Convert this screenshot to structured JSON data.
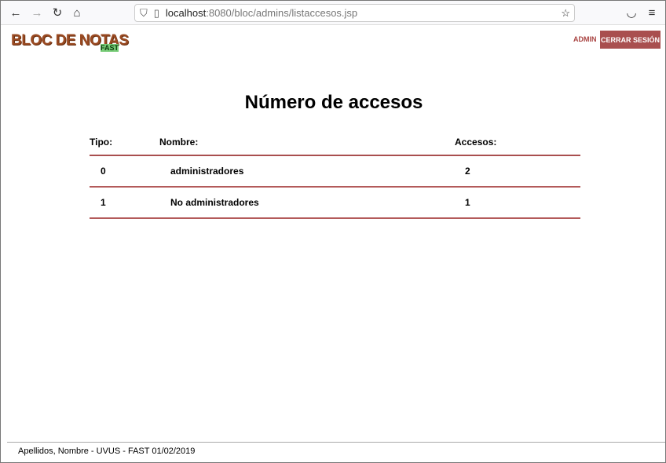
{
  "browser": {
    "url_host": "localhost",
    "url_path": ":8080/bloc/admins/listaccesos.jsp"
  },
  "header": {
    "logo": "BLOC DE NOTAS",
    "logo_sub": "FAST",
    "admin_link": "ADMIN",
    "logout": "CERRAR SESIÓN"
  },
  "page": {
    "title": "Número de accesos"
  },
  "table": {
    "headers": [
      "Tipo:",
      "Nombre:",
      "Accesos:"
    ],
    "rows": [
      [
        "0",
        "administradores",
        "2"
      ],
      [
        "1",
        "No administradores",
        "1"
      ]
    ]
  },
  "footer": "Apellidos, Nombre - UVUS - FAST 01/02/2019"
}
